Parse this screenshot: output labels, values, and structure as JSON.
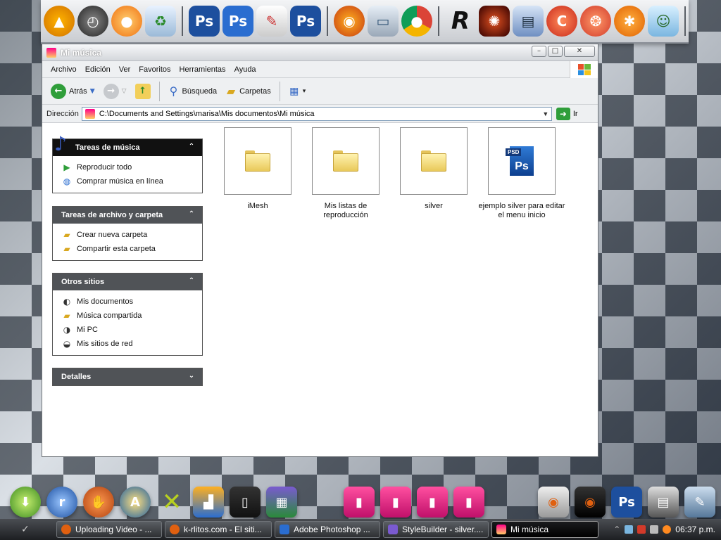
{
  "window": {
    "title": "Mi música",
    "minimize": "–",
    "maximize": "□",
    "close": "✕"
  },
  "menu": [
    "Archivo",
    "Edición",
    "Ver",
    "Favoritos",
    "Herramientas",
    "Ayuda"
  ],
  "toolbar": {
    "back": "Atrás",
    "search": "Búsqueda",
    "folders": "Carpetas"
  },
  "address": {
    "label": "Dirección",
    "path": "C:\\Documents and Settings\\marisa\\Mis documentos\\Mi música",
    "go": "Ir"
  },
  "panes": {
    "music_tasks": {
      "title": "Tareas de música",
      "items": [
        "Reproducir todo",
        "Comprar música en línea"
      ]
    },
    "file_tasks": {
      "title": "Tareas de archivo y carpeta",
      "items": [
        "Crear nueva carpeta",
        "Compartir esta carpeta"
      ]
    },
    "other_places": {
      "title": "Otros sitios",
      "items": [
        "Mis documentos",
        "Música compartida",
        "Mi PC",
        "Mis sitios de red"
      ]
    },
    "details": {
      "title": "Detalles"
    }
  },
  "files": [
    {
      "name": "iMesh",
      "type": "folder"
    },
    {
      "name": "Mis listas de reproducción",
      "type": "folder"
    },
    {
      "name": "silver",
      "type": "folder"
    },
    {
      "name": "ejemplo silver para editar el menu inicio",
      "type": "psd"
    }
  ],
  "psd_tag": "PSD",
  "psd_letters": "Ps",
  "taskbar": {
    "tasks": [
      "Uploading Video - ...",
      "k-rlitos.com - El siti...",
      "Adobe Photoshop ...",
      "StyleBuilder - silver....",
      "Mi música"
    ],
    "clock": "06:37 p.m."
  },
  "colors": {
    "pane_header": "#505357",
    "pane_header_active": "#111111",
    "taskbar": "#1d1f22",
    "go_green": "#2f9e3a"
  }
}
